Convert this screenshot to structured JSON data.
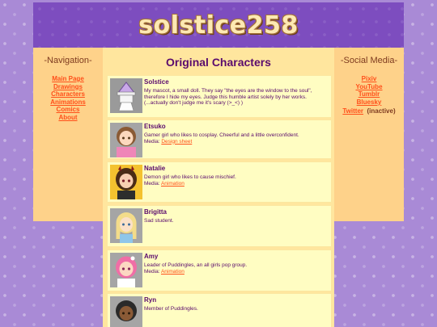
{
  "site": {
    "title": "solstice258"
  },
  "navigation": {
    "heading": "-Navigation-",
    "links": [
      "Main Page",
      "Drawings",
      "Characters",
      "Animations",
      "Comics",
      "About"
    ]
  },
  "social": {
    "heading": "-Social Media-",
    "links": [
      "Pixiv",
      "YouTube",
      "Tumblr",
      "Bluesky",
      "Twitter"
    ],
    "inactive_note": "(inactive)"
  },
  "main": {
    "title": "Original Characters",
    "characters": [
      {
        "name": "Solstice",
        "description": "My mascot, a small doll. They say \"the eyes are the window to the soul\", therefore I hide my eyes. Judge this humble artist solely by her works. (...actually don't judge me it's scary (>_<) )",
        "media_label": "",
        "media_link": ""
      },
      {
        "name": "Etsuko",
        "description": "Gamer girl who likes to cosplay. Cheerful and a little overconfident.",
        "media_label": "Media:",
        "media_link": "Design sheet"
      },
      {
        "name": "Natalie",
        "description": "Demon girl who likes to cause mischief.",
        "media_label": "Media:",
        "media_link": "Animation"
      },
      {
        "name": "Brigitta",
        "description": "Sad student.",
        "media_label": "",
        "media_link": ""
      },
      {
        "name": "Amy",
        "description": "Leader of Puddingles, an all girls pop group.",
        "media_label": "Media:",
        "media_link": "Animation"
      },
      {
        "name": "Ryn",
        "description": "Member of Puddingles.",
        "media_label": "",
        "media_link": ""
      }
    ]
  },
  "colors": {
    "background": "#a98ad6",
    "banner": "#7d4dbf",
    "side_panel": "#fed28a",
    "main_panel": "#ffe69e",
    "card": "#fffdc2",
    "link": "#ff4f1a",
    "text": "#5a0b6d"
  }
}
